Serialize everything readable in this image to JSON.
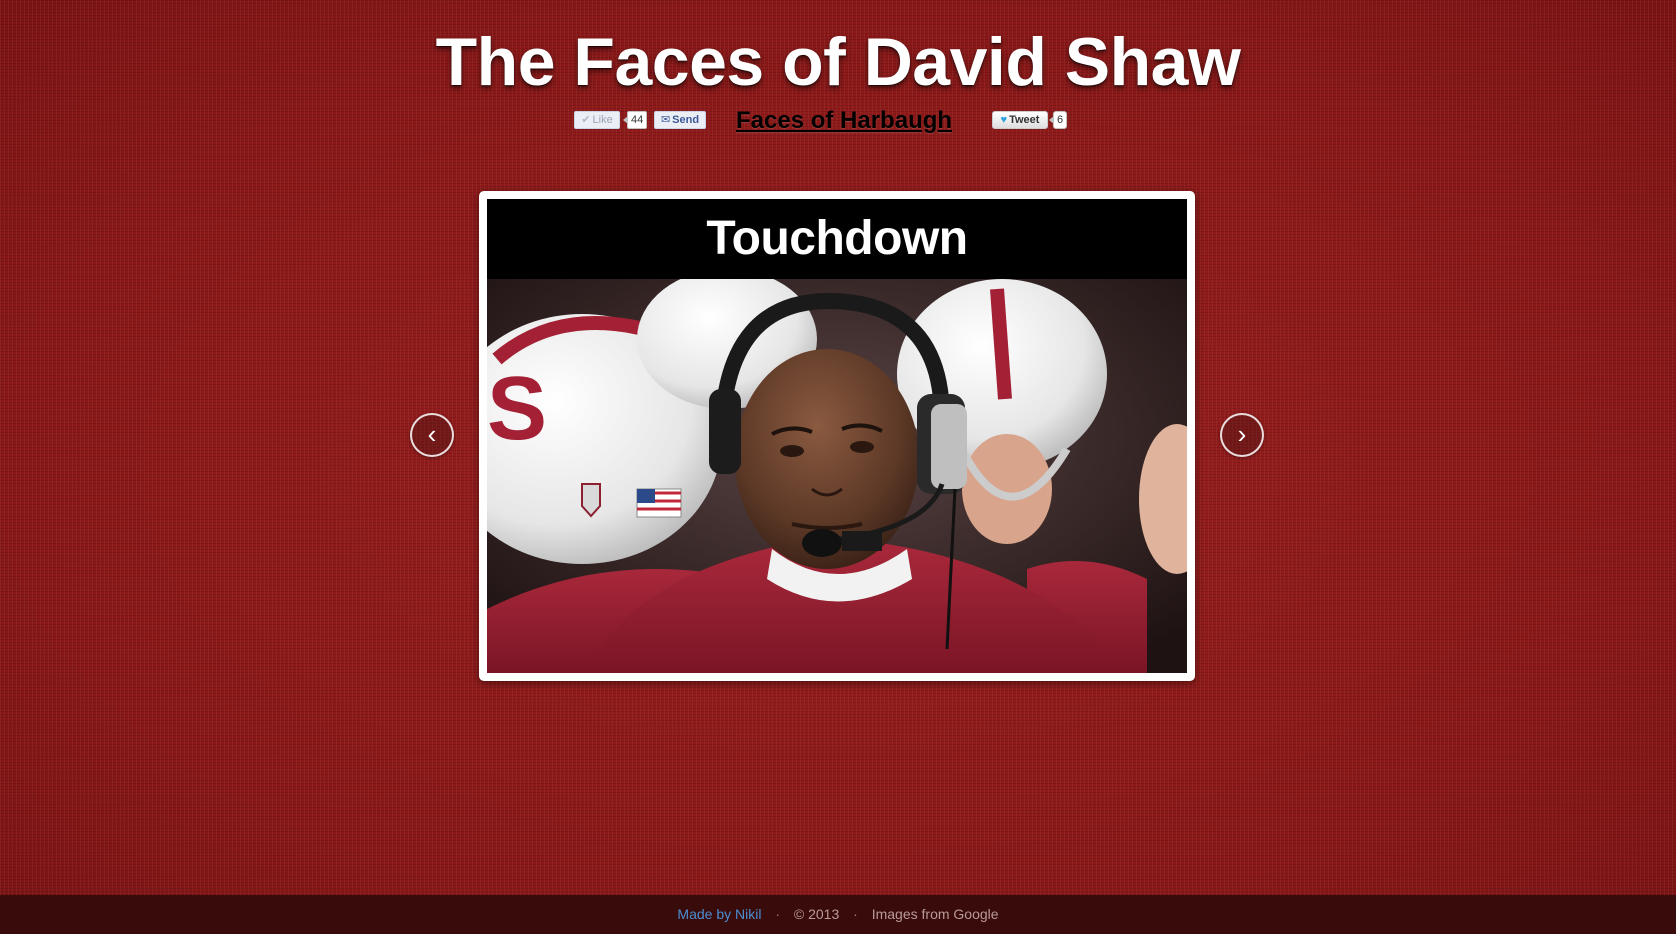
{
  "header": {
    "title": "The Faces of David Shaw"
  },
  "social": {
    "like_label": "Like",
    "like_count": "44",
    "send_label": "Send",
    "link_label": "Faces of Harbaugh",
    "tweet_label": "Tweet",
    "tweet_count": "6"
  },
  "carousel": {
    "caption": "Touchdown",
    "prev_label": "‹",
    "next_label": "›"
  },
  "footer": {
    "made_by": "Made by Nikil",
    "separator": "·",
    "copyright": "© 2013",
    "images_credit": "Images from Google"
  },
  "colors": {
    "background": "#8e1a1a",
    "footer_bg": "#3a0b0b",
    "link_blue": "#4a8fd1"
  }
}
